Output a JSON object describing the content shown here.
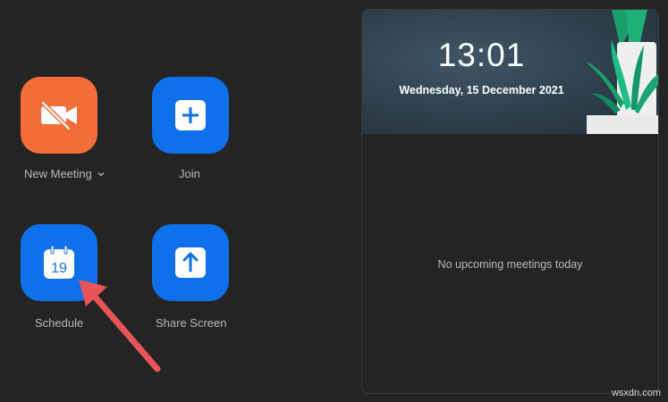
{
  "actions": {
    "new_meeting": {
      "label": "New Meeting",
      "icon": "video-off-icon"
    },
    "join": {
      "label": "Join",
      "icon": "plus-icon"
    },
    "schedule": {
      "label": "Schedule",
      "icon": "calendar-icon",
      "calendar_day": "19"
    },
    "share_screen": {
      "label": "Share Screen",
      "icon": "upload-arrow-icon"
    }
  },
  "panel": {
    "time": "13:01",
    "date": "Wednesday, 15 December 2021",
    "empty_message": "No upcoming meetings today"
  },
  "watermark": "wsxdn.com",
  "colors": {
    "background": "#242424",
    "new_meeting_tile": "#f26d37",
    "action_tile": "#0e71eb",
    "annotation_arrow": "#e8545a"
  }
}
